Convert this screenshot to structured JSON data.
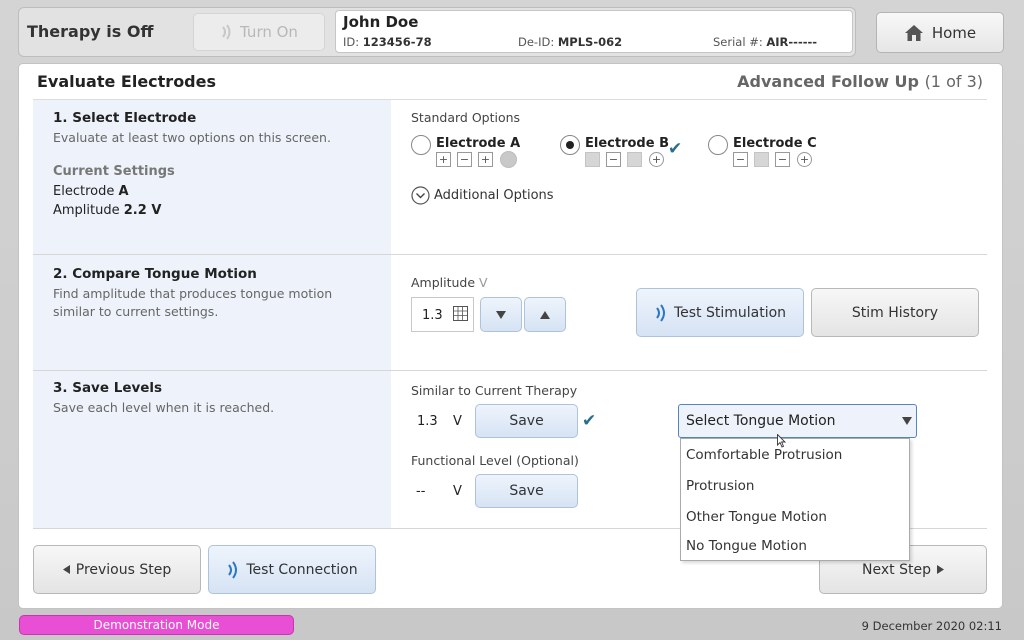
{
  "topbar": {
    "therapy_status": "Therapy is Off",
    "turn_on_label": "Turn On",
    "home_label": "Home"
  },
  "patient": {
    "name": "John Doe",
    "id_label": "ID:",
    "id_value": "123456-78",
    "deid_label": "De-ID:",
    "deid_value": "MPLS-062",
    "serial_label": "Serial #:",
    "serial_value": "AIR------"
  },
  "header": {
    "title": "Evaluate Electrodes",
    "followup": "Advanced Follow Up",
    "step_counter": "(1  of  3)"
  },
  "step1": {
    "title": "1. Select Electrode",
    "desc": "Evaluate at least two options on this screen.",
    "current_settings_title": "Current Settings",
    "electrode_label": "Electrode",
    "electrode_value": "A",
    "amplitude_label": "Amplitude",
    "amplitude_value": "2.2 V",
    "standard_options": "Standard Options",
    "electrodes": [
      {
        "label": "Electrode A",
        "selected": false
      },
      {
        "label": "Electrode B",
        "selected": true
      },
      {
        "label": "Electrode C",
        "selected": false
      }
    ],
    "contacts_a": [
      "+",
      "−",
      "+",
      ""
    ],
    "contacts_b": [
      "",
      "−",
      "",
      "+"
    ],
    "contacts_c": [
      "−",
      "",
      "−",
      "+"
    ],
    "additional_options": "Additional Options"
  },
  "step2": {
    "title": "2. Compare Tongue Motion",
    "desc": "Find amplitude that produces tongue motion similar to current settings.",
    "amplitude_label": "Amplitude",
    "amplitude_unit": "V",
    "amplitude_value": "1.3",
    "test_stimulation": "Test Stimulation",
    "stim_history": "Stim History"
  },
  "step3": {
    "title": "3. Save Levels",
    "desc": "Save each level when it is reached.",
    "similar_label": "Similar to Current Therapy",
    "similar_value": "1.3",
    "unit": "V",
    "save_label": "Save",
    "functional_label": "Functional Level (Optional)",
    "functional_value": "--",
    "tongue_select": "Select Tongue Motion",
    "tongue_options": [
      "Comfortable Protrusion",
      "Protrusion",
      "Other Tongue Motion",
      "No Tongue Motion"
    ]
  },
  "footer": {
    "previous": "Previous Step",
    "test_connection": "Test Connection",
    "next": "Next Step",
    "demo_mode": "Demonstration Mode",
    "datetime": "9 December 2020 02:11"
  },
  "colors": {
    "accent_blue": "#2a6e8a",
    "demo_pink": "#e84fd4",
    "left_panel": "#eef3fb"
  }
}
